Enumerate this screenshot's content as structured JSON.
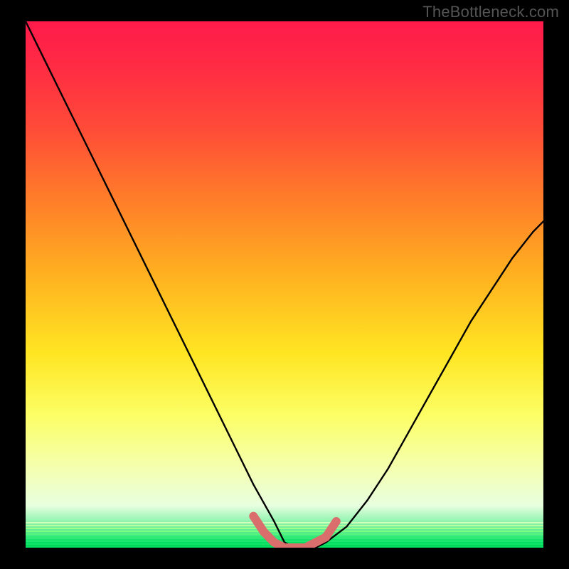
{
  "watermark": "TheBottleneck.com",
  "colors": {
    "background": "#000000",
    "watermark": "#555555",
    "curve_black": "#000000",
    "curve_pink": "#d96e6c",
    "gradient_stops": [
      "#ff1a4b",
      "#ff2a44",
      "#ff4a38",
      "#ff7a2a",
      "#ffb020",
      "#ffe522",
      "#fcff66",
      "#f4ffb0",
      "#e8ffe0",
      "#00e060"
    ]
  },
  "chart_data": {
    "type": "line",
    "title": "",
    "xlabel": "",
    "ylabel": "",
    "xlim": [
      0,
      100
    ],
    "ylim": [
      0,
      100
    ],
    "series": [
      {
        "name": "bottleneck-curve",
        "x": [
          0,
          4,
          8,
          12,
          16,
          20,
          24,
          28,
          32,
          36,
          40,
          44,
          48,
          50,
          52,
          54,
          56,
          58,
          62,
          66,
          70,
          74,
          78,
          82,
          86,
          90,
          94,
          98,
          100
        ],
        "y": [
          100,
          92,
          84,
          76,
          68,
          60,
          52,
          44,
          36,
          28,
          20,
          12,
          5,
          1,
          0,
          0,
          0,
          1,
          4,
          9,
          15,
          22,
          29,
          36,
          43,
          49,
          55,
          60,
          62
        ]
      }
    ],
    "highlight": {
      "name": "optimal-zone",
      "x": [
        44,
        46,
        48,
        50,
        52,
        54,
        56,
        58,
        60
      ],
      "y": [
        6,
        3,
        1,
        0,
        0,
        0,
        1,
        2,
        5
      ]
    }
  }
}
